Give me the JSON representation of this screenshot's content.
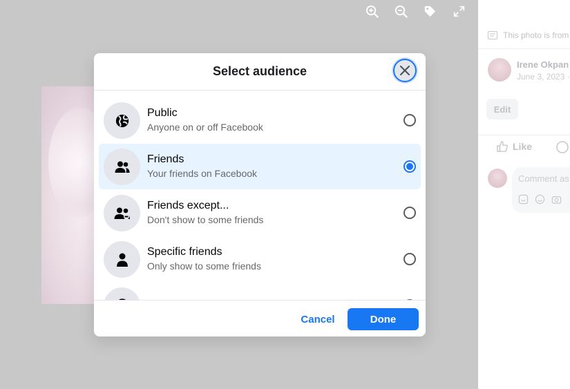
{
  "viewer": {
    "tools": [
      {
        "icon": "zoom-in-icon"
      },
      {
        "icon": "zoom-out-icon"
      },
      {
        "icon": "tag-icon"
      },
      {
        "icon": "fullscreen-icon"
      }
    ]
  },
  "side_panel": {
    "notice": "This photo is from",
    "author_name": "Irene Okpan",
    "author_date": "June 3, 2023 ·",
    "edit_label": "Edit",
    "like_label": "Like",
    "comment_placeholder": "Comment as"
  },
  "modal": {
    "title": "Select audience",
    "options": [
      {
        "label": "Public",
        "desc": "Anyone on or off Facebook",
        "icon": "globe-icon",
        "selected": false
      },
      {
        "label": "Friends",
        "desc": "Your friends on Facebook",
        "icon": "friends-icon",
        "selected": true
      },
      {
        "label": "Friends except...",
        "desc": "Don't show to some friends",
        "icon": "friends-except-icon",
        "selected": false
      },
      {
        "label": "Specific friends",
        "desc": "Only show to some friends",
        "icon": "person-icon",
        "selected": false
      }
    ],
    "cancel_label": "Cancel",
    "done_label": "Done"
  },
  "colors": {
    "accent": "#1877f2",
    "selected_bg": "#e7f3ff",
    "icon_bg": "#e4e6eb",
    "backdrop": "#c8c8c8"
  }
}
